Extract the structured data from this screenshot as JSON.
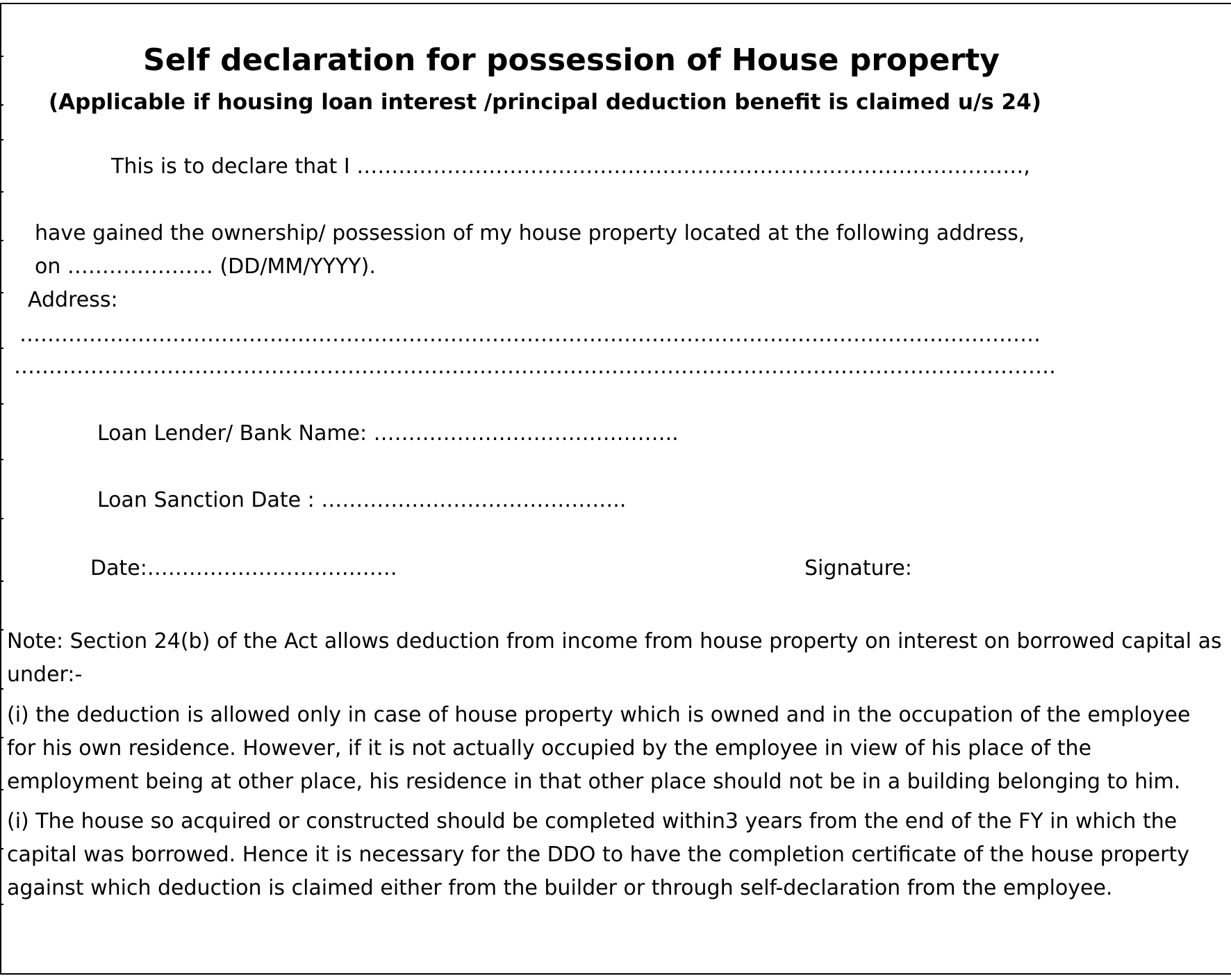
{
  "form": {
    "title": "Self declaration for possession of House property",
    "subtitle": "(Applicable if housing loan interest /principal deduction benefit is claimed u/s 24)",
    "declare_line": "This is to declare that I ……………………………………………………………………………………,",
    "ownership_line": "have gained the ownership/ possession of my house property located at the following address,",
    "date_line": "on ………………… (DD/MM/YYYY).",
    "address_label": "Address:",
    "address_line_1": "…………………………………………………………………………………………………………………………………",
    "address_line_2": "……………………………………………………………………………………………………………………………………",
    "lender_line": "Loan Lender/ Bank Name: ……………………………………..",
    "sanction_line": "Loan Sanction Date : ……………………………………..",
    "date_field": "Date:………………………………",
    "signature_label": "Signature:"
  },
  "notes": {
    "intro": "Note: Section 24(b) of the Act allows deduction from income from house property on interest on borrowed capital as under:-",
    "point_1": "(i) the deduction is allowed only in case of house property which is owned and in the occupation of the employee for his own residence. However, if it is not actually occupied by the employee in view of his place of the employment being at other place, his residence in that other place should not be in a building belonging to him.",
    "point_2": "(i) The house so acquired or constructed should be completed within3 years from the end of the FY in which the capital was borrowed. Hence it is necessary for the DDO to have the completion certificate of the house property against which deduction is claimed either from the builder or through self-declaration from the employee."
  }
}
